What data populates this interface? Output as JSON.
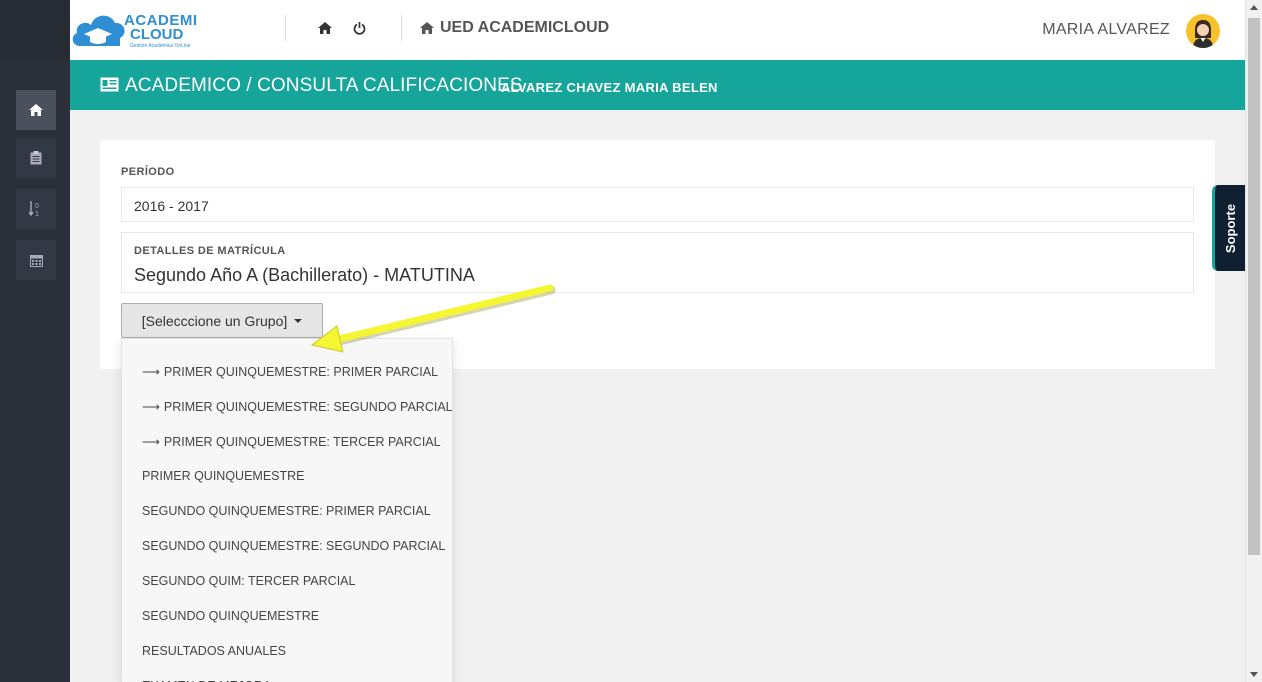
{
  "app": {
    "logo_line1": "ACADEMI",
    "logo_line2": "CLOUD",
    "logo_tagline": "Gestión Académica OnLine",
    "brand": "UED ACADEMICLOUD",
    "user_name": "MARIA ALVAREZ"
  },
  "sidebar": {
    "items": [
      {
        "icon": "home-icon",
        "active": true
      },
      {
        "icon": "clipboard-icon",
        "active": false
      },
      {
        "icon": "sort-numeric-icon",
        "active": false
      },
      {
        "icon": "calendar-icon",
        "active": false
      }
    ]
  },
  "header": {
    "breadcrumb": "ACADEMICO / CONSULTA CALIFICACIONES",
    "student": "ALVAREZ CHAVEZ MARIA BELEN"
  },
  "form": {
    "period_label": "PERÍODO",
    "period_value": "2016 - 2017",
    "details_label": "DETALLES DE MATRÍCULA",
    "details_value": "Segundo Año A (Bachillerato) - MATUTINA",
    "group_button": "[Selecccione un Grupo]"
  },
  "dropdown": {
    "items": [
      {
        "label": "PRIMER QUINQUEMESTRE: PRIMER PARCIAL",
        "arrow": true
      },
      {
        "label": "PRIMER QUINQUEMESTRE: SEGUNDO PARCIAL",
        "arrow": true
      },
      {
        "label": "PRIMER QUINQUEMESTRE: TERCER PARCIAL",
        "arrow": true
      },
      {
        "label": "PRIMER QUINQUEMESTRE",
        "arrow": false
      },
      {
        "label": "SEGUNDO QUINQUEMESTRE: PRIMER PARCIAL",
        "arrow": false
      },
      {
        "label": "SEGUNDO QUINQUEMESTRE: SEGUNDO PARCIAL",
        "arrow": false
      },
      {
        "label": "SEGUNDO QUIM: TERCER PARCIAL",
        "arrow": false
      },
      {
        "label": "SEGUNDO QUINQUEMESTRE",
        "arrow": false
      },
      {
        "label": "RESULTADOS ANUALES",
        "arrow": false
      },
      {
        "label": "EXAMEN DE MEJORA",
        "arrow": false
      }
    ],
    "arrow_glyph": "⟶"
  },
  "support": {
    "label": "Soporte"
  },
  "colors": {
    "accent": "#16a59a",
    "sidebar": "#2a2f39",
    "annotation_arrow": "#f5f532"
  }
}
